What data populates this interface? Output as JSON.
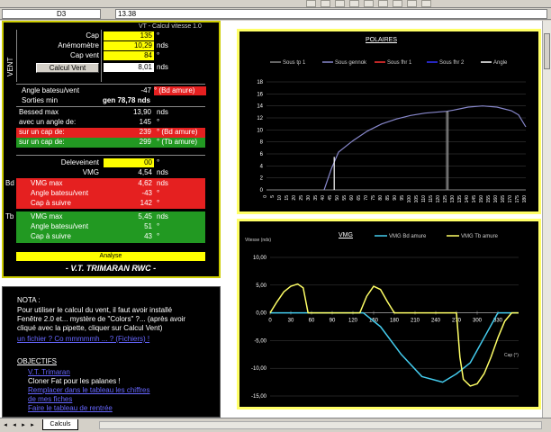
{
  "window": {
    "namebox": "D3",
    "formula": "13.38"
  },
  "calc": {
    "header": "VT - Calcul vitesse 1.0",
    "side_label": "VENT",
    "rows": [
      {
        "label": "Cap",
        "value": "135",
        "unit": "°"
      },
      {
        "label": "Anémomètre",
        "value": "10,29",
        "unit": "nds"
      },
      {
        "label": "Cap vent",
        "value": "84",
        "unit": "°"
      },
      {
        "label": "Calcul Vent",
        "value": "8,01",
        "unit": "nds"
      }
    ],
    "angle_label": "Angle batesu/vent",
    "angle_value": "-47",
    "angle_note": "° (Bd amure)",
    "bearing_label": "Sorties min",
    "bearing_value": "gen 78,78 nds",
    "speed_rows": [
      {
        "label": "Bessed max",
        "value": "13,90",
        "unit": "nds"
      },
      {
        "label": "avec un angle de:",
        "value": "145",
        "unit": "°"
      },
      {
        "label": "sur un cap de:",
        "value": "239",
        "unit": "° (Bd amure)"
      },
      {
        "label": "sur un cap de:",
        "value": "299",
        "unit": "° (Tb amure)"
      }
    ],
    "vmg": {
      "delev_label": "Deleveinent",
      "delev_value": "00",
      "delev_unit": "°",
      "vmg_label": "VMG",
      "vmg_value": "4,54",
      "vmg_unit": "nds"
    },
    "bd": {
      "side": "Bd",
      "rows": [
        {
          "label": "VMG max",
          "value": "4,62",
          "unit": "nds"
        },
        {
          "label": "Angle batesu/vent",
          "value": "-43",
          "unit": "°"
        },
        {
          "label": "Cap à suivre",
          "value": "142",
          "unit": "°"
        }
      ]
    },
    "tb": {
      "side": "Tb",
      "rows": [
        {
          "label": "VMG max",
          "value": "5,45",
          "unit": "nds"
        },
        {
          "label": "Angle batesu/vent",
          "value": "51",
          "unit": "°"
        },
        {
          "label": "Cap à suivre",
          "value": "43",
          "unit": "°"
        }
      ]
    },
    "analyse_label": "Analyse",
    "brand": "- V.T. TRIMARAN RWC -"
  },
  "notes": {
    "title": "NOTA :",
    "lines": [
      "Pour utiliser le calcul du vent, il faut avoir installé",
      "Fenêtre 2.0 et... mystère de \"Colors\" ?... (après avoir",
      "cliqué avec la pipette, cliquer sur Calcul Vent)"
    ],
    "link_top": "un fichier ? Co mmmmmh ... ? (Fichiers) !",
    "objectives_title": "OBJECTIFS",
    "objectives": [
      {
        "text": "V.T. Trimaran",
        "link": true
      },
      {
        "text": "Cloner Fat pour les palanes !",
        "link": false
      },
      {
        "text": "Remplacer dans le tableau les chiffres",
        "link": true
      },
      {
        "text": "de mes fiches",
        "link": true
      },
      {
        "text": "Faire le tableau de rentrée",
        "link": true
      }
    ]
  },
  "polar_chart": {
    "title": "POLAIRES",
    "legend": [
      {
        "name": "Sous tp 1",
        "color": "#888888"
      },
      {
        "name": "Sous gennok",
        "color": "#8888cc"
      },
      {
        "name": "Sous fhr 1",
        "color": "#ff3333"
      },
      {
        "name": "Sous fhr 2",
        "color": "#3333ff"
      },
      {
        "name": "Angle",
        "color": "#ffffff"
      }
    ],
    "y_ticks": [
      "0",
      "2",
      "4",
      "6",
      "8",
      "10",
      "12",
      "14",
      "16",
      "18"
    ],
    "x_ticks": [
      "0",
      "5",
      "10",
      "15",
      "20",
      "25",
      "30",
      "35",
      "40",
      "45",
      "50",
      "55",
      "60",
      "65",
      "70",
      "75",
      "80",
      "85",
      "90",
      "95",
      "100",
      "105",
      "110",
      "115",
      "120",
      "125",
      "130",
      "135",
      "140",
      "145",
      "150",
      "155",
      "160",
      "165",
      "170",
      "175",
      "180"
    ]
  },
  "vmg_chart": {
    "title": "VMG",
    "legend": [
      {
        "name": "VMG Bd amure",
        "color": "#44ccee"
      },
      {
        "name": "VMG Tb amure",
        "color": "#ffff66"
      }
    ],
    "y_label": "Vitesse (nds)",
    "x_label": "Cap (°)",
    "y_ticks": [
      "10,00",
      "5,00",
      "0,00",
      "-5,00",
      "-10,00",
      "-15,00"
    ],
    "x_ticks": [
      "0",
      "30",
      "60",
      "90",
      "120",
      "150",
      "180",
      "210",
      "240",
      "270",
      "300",
      "330"
    ]
  },
  "chart_data": [
    {
      "type": "line",
      "title": "POLAIRES",
      "xlabel": "",
      "ylabel": "",
      "xlim": [
        0,
        180
      ],
      "ylim": [
        0,
        18
      ],
      "grid": true,
      "legend_position": "top",
      "series": [
        {
          "name": "Sous gennok",
          "x": [
            40,
            45,
            50,
            60,
            70,
            80,
            90,
            100,
            110,
            120,
            125,
            130,
            140,
            150,
            160,
            170,
            175,
            180
          ],
          "values": [
            0,
            3.5,
            6.3,
            8.2,
            9.8,
            11.0,
            11.8,
            12.4,
            12.8,
            13.0,
            13.1,
            13.3,
            13.8,
            14.0,
            13.8,
            13.2,
            12.5,
            10.5
          ]
        },
        {
          "name": "Sous tp 1",
          "x": [
            125,
            125,
            126,
            126
          ],
          "values": [
            0,
            13.0,
            13.0,
            0
          ]
        },
        {
          "name": "Angle",
          "x": [
            47,
            47
          ],
          "values": [
            0,
            5.5
          ]
        }
      ]
    },
    {
      "type": "line",
      "title": "VMG",
      "xlabel": "Cap (°)",
      "ylabel": "Vitesse (nds)",
      "xlim": [
        0,
        360
      ],
      "ylim": [
        -15,
        10
      ],
      "grid": true,
      "legend_position": "top",
      "series": [
        {
          "name": "VMG Bd amure",
          "x": [
            0,
            45,
            90,
            135,
            160,
            190,
            220,
            250,
            270,
            290,
            310,
            330,
            350,
            360
          ],
          "values": [
            0,
            0,
            0,
            0,
            -2.5,
            -7.5,
            -11.5,
            -12.5,
            -11.0,
            -9.0,
            -4.5,
            0,
            0,
            0
          ]
        },
        {
          "name": "VMG Tb amure",
          "x": [
            0,
            10,
            20,
            30,
            40,
            48,
            55,
            60,
            130,
            140,
            150,
            160,
            170,
            180,
            270,
            275,
            280,
            290,
            300,
            310,
            320,
            330,
            340,
            350,
            360
          ],
          "values": [
            0,
            2.0,
            3.8,
            4.8,
            5.2,
            4.5,
            0,
            0,
            0,
            3.0,
            4.8,
            4.2,
            2.0,
            0,
            0,
            -8.0,
            -12.0,
            -13.2,
            -12.8,
            -11.0,
            -8.0,
            -4.5,
            -1.5,
            0,
            0
          ]
        }
      ]
    }
  ]
}
